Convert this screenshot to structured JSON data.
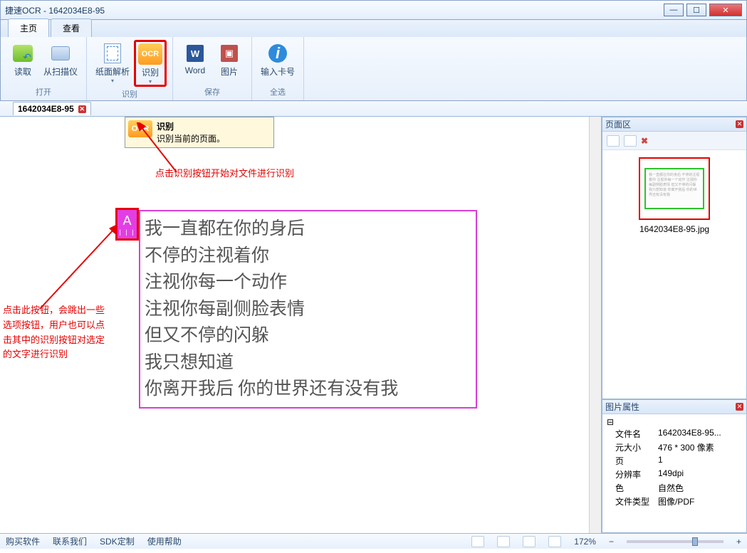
{
  "window": {
    "title": "捷速OCR - 1642034E8-95",
    "min": "—",
    "max": "☐",
    "close": "✕"
  },
  "tabs": [
    {
      "label": "主页",
      "active": true
    },
    {
      "label": "查看",
      "active": false
    }
  ],
  "ribbon": {
    "groups": [
      {
        "label": "打开",
        "items": [
          {
            "name": "读取",
            "icon": "folder"
          },
          {
            "name": "从扫描仪",
            "icon": "scan"
          }
        ]
      },
      {
        "label": "识别",
        "items": [
          {
            "name": "纸面解析",
            "icon": "page",
            "drop": true
          },
          {
            "name": "识别",
            "icon": "ocr",
            "drop": true,
            "highlight": true
          }
        ]
      },
      {
        "label": "保存",
        "items": [
          {
            "name": "Word",
            "icon": "word"
          },
          {
            "name": "图片",
            "icon": "img"
          }
        ]
      },
      {
        "label": "全选",
        "items": [
          {
            "name": "输入卡号",
            "icon": "info"
          }
        ]
      }
    ]
  },
  "tooltip": {
    "title": "识别",
    "body": "识别当前的页面。"
  },
  "annotations": {
    "top": "点击识别按钮开始对文件进行识别",
    "left": "点击此按钮，会跳出一些选项按钮，用户也可以点击其中的识别按钮对选定的文字进行识别"
  },
  "doc": {
    "tab_label": "1642034E8-95",
    "a_badge": "A",
    "lines": [
      "我一直都在你的身后",
      "不停的注视着你",
      "注视你每一个动作",
      "注视你每副侧脸表情",
      "但又不停的闪躲",
      "我只想知道",
      "你离开我后 你的世界还有没有我"
    ]
  },
  "panels": {
    "pages": {
      "title": "页面区",
      "thumb_label": "1642034E8-95.jpg"
    },
    "props": {
      "title": "图片属性",
      "rows": [
        {
          "k": "文件名",
          "v": "1642034E8-95..."
        },
        {
          "k": "元大小",
          "v": "476 * 300 像素"
        },
        {
          "k": "页",
          "v": "1"
        },
        {
          "k": "分辨率",
          "v": "149dpi"
        },
        {
          "k": "色",
          "v": "自然色"
        },
        {
          "k": "文件类型",
          "v": "图像/PDF"
        }
      ]
    }
  },
  "status": {
    "links": [
      "购买软件",
      "联系我们",
      "SDK定制",
      "使用帮助"
    ],
    "zoom": "172%"
  }
}
